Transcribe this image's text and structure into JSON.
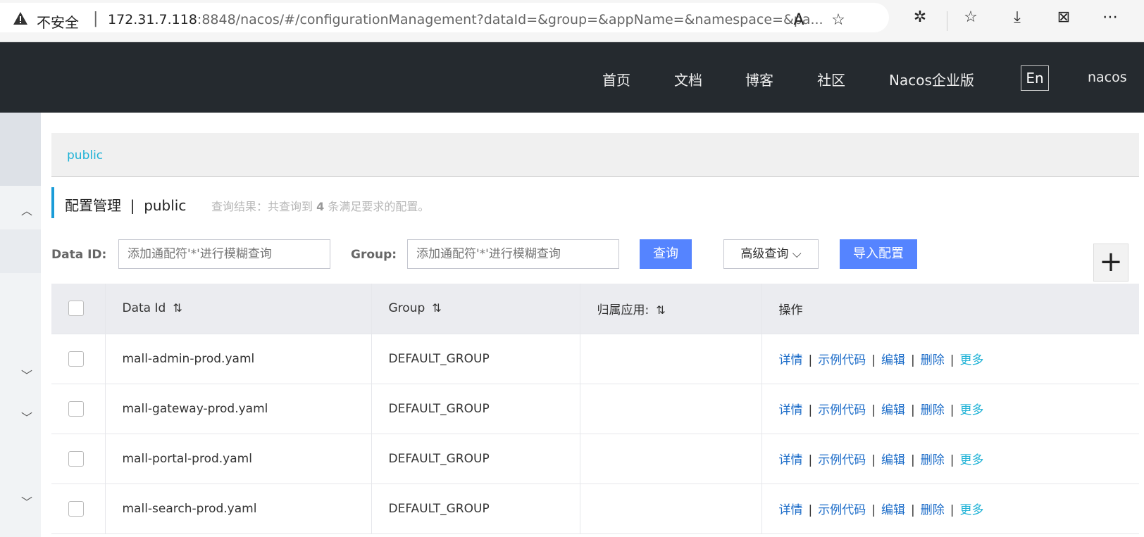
{
  "browser": {
    "insecure_label": "不安全",
    "url_host": "172.31.7.118",
    "url_rest": ":8848/nacos/#/configurationManagement?dataId=&group=&appName=&namespace=&pa..."
  },
  "topnav": {
    "items": [
      "首页",
      "文档",
      "博客",
      "社区",
      "Nacos企业版"
    ],
    "lang": "En",
    "user": "nacos"
  },
  "namespace": {
    "current": "public"
  },
  "header": {
    "title": "配置管理",
    "separator": "|",
    "namespace": "public",
    "result_prefix": "查询结果：共查询到",
    "result_count": "4",
    "result_suffix": "条满足要求的配置。"
  },
  "search": {
    "dataid_label": "Data ID:",
    "dataid_placeholder": "添加通配符'*'进行模糊查询",
    "group_label": "Group:",
    "group_placeholder": "添加通配符'*'进行模糊查询",
    "query_button": "查询",
    "advanced_button": "高级查询",
    "import_button": "导入配置"
  },
  "table": {
    "columns": [
      "Data Id",
      "Group",
      "归属应用:",
      "操作"
    ],
    "rows": [
      {
        "data_id": "mall-admin-prod.yaml",
        "group": "DEFAULT_GROUP",
        "app": ""
      },
      {
        "data_id": "mall-gateway-prod.yaml",
        "group": "DEFAULT_GROUP",
        "app": ""
      },
      {
        "data_id": "mall-portal-prod.yaml",
        "group": "DEFAULT_GROUP",
        "app": ""
      },
      {
        "data_id": "mall-search-prod.yaml",
        "group": "DEFAULT_GROUP",
        "app": ""
      }
    ],
    "actions": {
      "detail": "详情",
      "sample": "示例代码",
      "edit": "编辑",
      "delete": "删除",
      "more": "更多"
    }
  },
  "colors": {
    "nav_bg": "#252a2f",
    "primary": "#5584ff",
    "link": "#1a6bc8",
    "accent": "#1fb2d6"
  }
}
